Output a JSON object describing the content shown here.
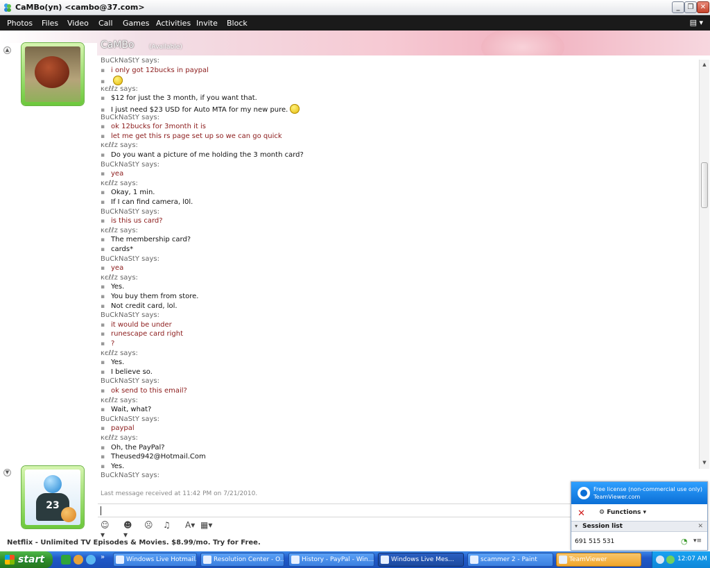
{
  "window": {
    "title": "CaMBo(yn) <cambo@37.com>",
    "buttons": [
      "_",
      "❐",
      "✕"
    ]
  },
  "menu": {
    "items": [
      "Photos",
      "Files",
      "Video",
      "Call",
      "Games",
      "Activities",
      "Invite",
      "Block"
    ],
    "right_icon": "menu-options-icon"
  },
  "contact": {
    "name": "CaMBo",
    "status": "(Available)"
  },
  "conversation": [
    {
      "type": "says",
      "text": "BuCkNaStY says:"
    },
    {
      "type": "msg",
      "who": "them",
      "text": "i only got 12bucks in paypal"
    },
    {
      "type": "msg",
      "who": "them",
      "text": "",
      "emoticon": "sad-emoticon"
    },
    {
      "type": "says",
      "text": "κєℓℓz says:"
    },
    {
      "type": "msg",
      "who": "me",
      "text": "$12 for just the 3 month, if you want that."
    },
    {
      "type": "msg",
      "who": "me",
      "text": "I just need $23 USD for Auto MTA for my new pure.",
      "emoticon": "tongue-emoticon"
    },
    {
      "type": "says",
      "text": "BuCkNaStY says:"
    },
    {
      "type": "msg",
      "who": "them",
      "text": "ok 12bucks for 3month it is"
    },
    {
      "type": "msg",
      "who": "them",
      "text": "let me get this rs page set up so we can go quick"
    },
    {
      "type": "says",
      "text": "κєℓℓz says:"
    },
    {
      "type": "msg",
      "who": "me",
      "text": "Do you want a picture of me holding the 3 month card?"
    },
    {
      "type": "says",
      "text": "BuCkNaStY says:"
    },
    {
      "type": "msg",
      "who": "them",
      "text": "yea"
    },
    {
      "type": "says",
      "text": "κєℓℓz says:"
    },
    {
      "type": "msg",
      "who": "me",
      "text": "Okay, 1 min."
    },
    {
      "type": "msg",
      "who": "me",
      "text": "If I can find camera, l0l."
    },
    {
      "type": "says",
      "text": "BuCkNaStY says:"
    },
    {
      "type": "msg",
      "who": "them",
      "text": "is this us card?"
    },
    {
      "type": "says",
      "text": "κєℓℓz says:"
    },
    {
      "type": "msg",
      "who": "me",
      "text": "The membership card?"
    },
    {
      "type": "msg",
      "who": "me",
      "text": "cards*"
    },
    {
      "type": "says",
      "text": "BuCkNaStY says:"
    },
    {
      "type": "msg",
      "who": "them",
      "text": "yea"
    },
    {
      "type": "says",
      "text": "κєℓℓz says:"
    },
    {
      "type": "msg",
      "who": "me",
      "text": "Yes."
    },
    {
      "type": "msg",
      "who": "me",
      "text": "You buy them from store."
    },
    {
      "type": "msg",
      "who": "me",
      "text": "Not credit card, lol."
    },
    {
      "type": "says",
      "text": "BuCkNaStY says:"
    },
    {
      "type": "msg",
      "who": "them",
      "text": "it would be under"
    },
    {
      "type": "msg",
      "who": "them",
      "text": "runescape card right"
    },
    {
      "type": "msg",
      "who": "them",
      "text": "?"
    },
    {
      "type": "says",
      "text": "κєℓℓz says:"
    },
    {
      "type": "msg",
      "who": "me",
      "text": "Yes."
    },
    {
      "type": "msg",
      "who": "me",
      "text": "I believe so."
    },
    {
      "type": "says",
      "text": "BuCkNaStY says:"
    },
    {
      "type": "msg",
      "who": "them",
      "text": "ok send to this email?"
    },
    {
      "type": "says",
      "text": "κєℓℓz says:"
    },
    {
      "type": "msg",
      "who": "me",
      "text": "Wait, what?"
    },
    {
      "type": "says",
      "text": "BuCkNaStY says:"
    },
    {
      "type": "msg",
      "who": "them",
      "text": "paypal"
    },
    {
      "type": "says",
      "text": "κєℓℓz says:"
    },
    {
      "type": "msg",
      "who": "me",
      "text": "Oh, the PayPal?"
    },
    {
      "type": "msg",
      "who": "me",
      "text": "Theused942@Hotmail.Com"
    },
    {
      "type": "msg",
      "who": "me",
      "text": "Yes."
    },
    {
      "type": "says",
      "text": "BuCkNaStY says:"
    }
  ],
  "footer": {
    "last_received": "Last message received at 11:42 PM on 7/21/2010.",
    "input_value": "",
    "ad": "Netflix - Unlimited TV Episodes & Movies. $8.99/mo. Try for Free."
  },
  "toolbar": {
    "tools": [
      {
        "icon": "emoticon-icon",
        "glyph": "☺▾"
      },
      {
        "icon": "wink-icon",
        "glyph": "☻▾"
      },
      {
        "icon": "nudge-icon",
        "glyph": "☹"
      },
      {
        "icon": "voice-clip-icon",
        "glyph": "♫"
      },
      {
        "icon": "font-icon",
        "glyph": "A▾"
      },
      {
        "icon": "background-icon",
        "glyph": "▦▾"
      }
    ]
  },
  "teamviewer": {
    "license_line1": "Free license (non-commercial use only)",
    "license_line2": "TeamViewer.com",
    "functions": "Functions",
    "session_title": "Session list",
    "session_id": "691 515 531"
  },
  "taskbar": {
    "start": "start",
    "tasks": [
      "Windows Live Hotmail...",
      "Resolution Center - O...",
      "History - PayPal - Win...",
      "Windows Live Mes...",
      "scammer 2 - Paint",
      "TeamViewer"
    ],
    "clock": "12:07 AM"
  }
}
